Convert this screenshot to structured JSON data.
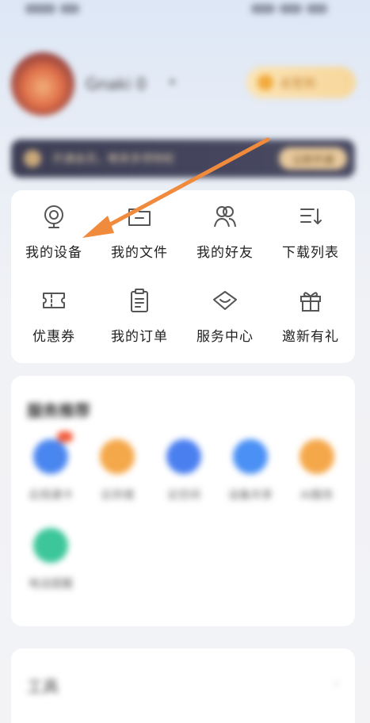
{
  "status_bar": {
    "left_text": "",
    "right_text": ""
  },
  "profile": {
    "username": "Gnaki 0"
  },
  "sign_in": {
    "label": "去签到"
  },
  "vip_banner": {
    "text": "开通会员，畅享多项特权",
    "button_label": "立即开通"
  },
  "functions": {
    "row1": [
      {
        "label": "我的设备",
        "icon": "camera-device-icon"
      },
      {
        "label": "我的文件",
        "icon": "folder-icon"
      },
      {
        "label": "我的好友",
        "icon": "friends-icon"
      },
      {
        "label": "下载列表",
        "icon": "download-list-icon"
      }
    ],
    "row2": [
      {
        "label": "优惠券",
        "icon": "coupon-icon"
      },
      {
        "label": "我的订单",
        "icon": "order-icon"
      },
      {
        "label": "服务中心",
        "icon": "service-center-icon"
      },
      {
        "label": "邀新有礼",
        "icon": "gift-icon"
      }
    ]
  },
  "recommend": {
    "title": "服务推荐",
    "items": [
      {
        "label": "云视通卡",
        "color": "#4a86f0"
      },
      {
        "label": "云存储",
        "color": "#f5a84a"
      },
      {
        "label": "云空间",
        "color": "#4a7ff0"
      },
      {
        "label": "设备共享",
        "color": "#4a90f5"
      },
      {
        "label": "AI服务",
        "color": "#f5a84a"
      },
      {
        "label": "电话提醒",
        "color": "#3cc69a"
      }
    ]
  },
  "bottom": {
    "title": "工具"
  },
  "colors": {
    "accent_orange": "#f08a3c",
    "icon_gray": "#555555"
  }
}
